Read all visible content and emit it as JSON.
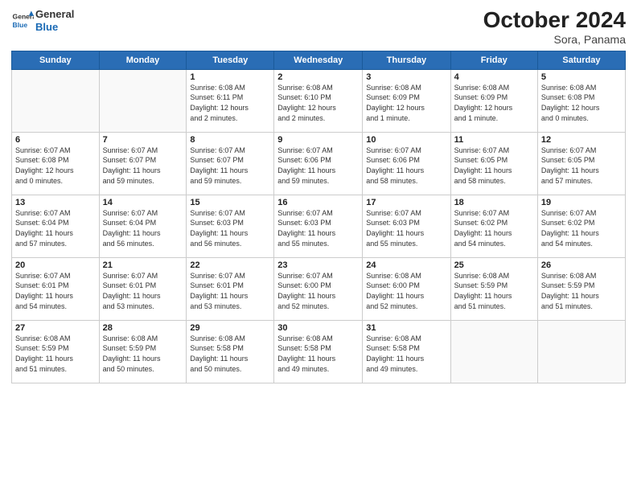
{
  "header": {
    "logo_line1": "General",
    "logo_line2": "Blue",
    "title": "October 2024",
    "subtitle": "Sora, Panama"
  },
  "weekdays": [
    "Sunday",
    "Monday",
    "Tuesday",
    "Wednesday",
    "Thursday",
    "Friday",
    "Saturday"
  ],
  "weeks": [
    [
      {
        "day": "",
        "info": ""
      },
      {
        "day": "",
        "info": ""
      },
      {
        "day": "1",
        "info": "Sunrise: 6:08 AM\nSunset: 6:11 PM\nDaylight: 12 hours\nand 2 minutes."
      },
      {
        "day": "2",
        "info": "Sunrise: 6:08 AM\nSunset: 6:10 PM\nDaylight: 12 hours\nand 2 minutes."
      },
      {
        "day": "3",
        "info": "Sunrise: 6:08 AM\nSunset: 6:09 PM\nDaylight: 12 hours\nand 1 minute."
      },
      {
        "day": "4",
        "info": "Sunrise: 6:08 AM\nSunset: 6:09 PM\nDaylight: 12 hours\nand 1 minute."
      },
      {
        "day": "5",
        "info": "Sunrise: 6:08 AM\nSunset: 6:08 PM\nDaylight: 12 hours\nand 0 minutes."
      }
    ],
    [
      {
        "day": "6",
        "info": "Sunrise: 6:07 AM\nSunset: 6:08 PM\nDaylight: 12 hours\nand 0 minutes."
      },
      {
        "day": "7",
        "info": "Sunrise: 6:07 AM\nSunset: 6:07 PM\nDaylight: 11 hours\nand 59 minutes."
      },
      {
        "day": "8",
        "info": "Sunrise: 6:07 AM\nSunset: 6:07 PM\nDaylight: 11 hours\nand 59 minutes."
      },
      {
        "day": "9",
        "info": "Sunrise: 6:07 AM\nSunset: 6:06 PM\nDaylight: 11 hours\nand 59 minutes."
      },
      {
        "day": "10",
        "info": "Sunrise: 6:07 AM\nSunset: 6:06 PM\nDaylight: 11 hours\nand 58 minutes."
      },
      {
        "day": "11",
        "info": "Sunrise: 6:07 AM\nSunset: 6:05 PM\nDaylight: 11 hours\nand 58 minutes."
      },
      {
        "day": "12",
        "info": "Sunrise: 6:07 AM\nSunset: 6:05 PM\nDaylight: 11 hours\nand 57 minutes."
      }
    ],
    [
      {
        "day": "13",
        "info": "Sunrise: 6:07 AM\nSunset: 6:04 PM\nDaylight: 11 hours\nand 57 minutes."
      },
      {
        "day": "14",
        "info": "Sunrise: 6:07 AM\nSunset: 6:04 PM\nDaylight: 11 hours\nand 56 minutes."
      },
      {
        "day": "15",
        "info": "Sunrise: 6:07 AM\nSunset: 6:03 PM\nDaylight: 11 hours\nand 56 minutes."
      },
      {
        "day": "16",
        "info": "Sunrise: 6:07 AM\nSunset: 6:03 PM\nDaylight: 11 hours\nand 55 minutes."
      },
      {
        "day": "17",
        "info": "Sunrise: 6:07 AM\nSunset: 6:03 PM\nDaylight: 11 hours\nand 55 minutes."
      },
      {
        "day": "18",
        "info": "Sunrise: 6:07 AM\nSunset: 6:02 PM\nDaylight: 11 hours\nand 54 minutes."
      },
      {
        "day": "19",
        "info": "Sunrise: 6:07 AM\nSunset: 6:02 PM\nDaylight: 11 hours\nand 54 minutes."
      }
    ],
    [
      {
        "day": "20",
        "info": "Sunrise: 6:07 AM\nSunset: 6:01 PM\nDaylight: 11 hours\nand 54 minutes."
      },
      {
        "day": "21",
        "info": "Sunrise: 6:07 AM\nSunset: 6:01 PM\nDaylight: 11 hours\nand 53 minutes."
      },
      {
        "day": "22",
        "info": "Sunrise: 6:07 AM\nSunset: 6:01 PM\nDaylight: 11 hours\nand 53 minutes."
      },
      {
        "day": "23",
        "info": "Sunrise: 6:07 AM\nSunset: 6:00 PM\nDaylight: 11 hours\nand 52 minutes."
      },
      {
        "day": "24",
        "info": "Sunrise: 6:08 AM\nSunset: 6:00 PM\nDaylight: 11 hours\nand 52 minutes."
      },
      {
        "day": "25",
        "info": "Sunrise: 6:08 AM\nSunset: 5:59 PM\nDaylight: 11 hours\nand 51 minutes."
      },
      {
        "day": "26",
        "info": "Sunrise: 6:08 AM\nSunset: 5:59 PM\nDaylight: 11 hours\nand 51 minutes."
      }
    ],
    [
      {
        "day": "27",
        "info": "Sunrise: 6:08 AM\nSunset: 5:59 PM\nDaylight: 11 hours\nand 51 minutes."
      },
      {
        "day": "28",
        "info": "Sunrise: 6:08 AM\nSunset: 5:59 PM\nDaylight: 11 hours\nand 50 minutes."
      },
      {
        "day": "29",
        "info": "Sunrise: 6:08 AM\nSunset: 5:58 PM\nDaylight: 11 hours\nand 50 minutes."
      },
      {
        "day": "30",
        "info": "Sunrise: 6:08 AM\nSunset: 5:58 PM\nDaylight: 11 hours\nand 49 minutes."
      },
      {
        "day": "31",
        "info": "Sunrise: 6:08 AM\nSunset: 5:58 PM\nDaylight: 11 hours\nand 49 minutes."
      },
      {
        "day": "",
        "info": ""
      },
      {
        "day": "",
        "info": ""
      }
    ]
  ]
}
